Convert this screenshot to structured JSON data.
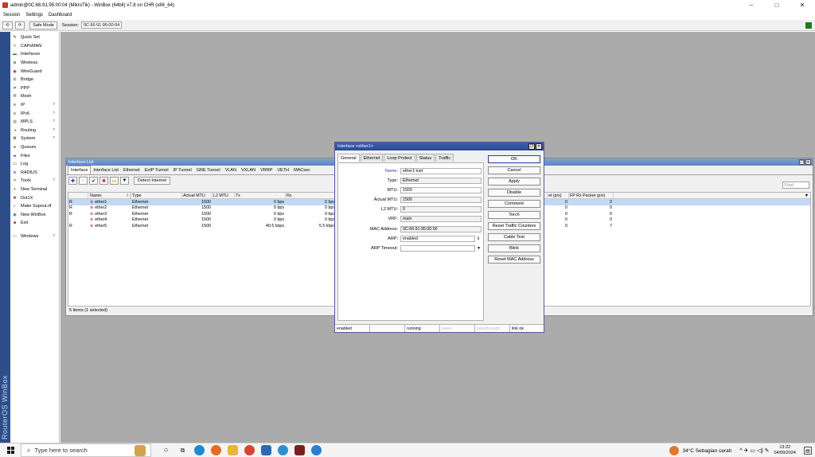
{
  "window": {
    "title": "admin@0C:66:91:95:00:04 (MikroTik) - WinBox (64bit) v7.8 on CHR (x86_64)",
    "minimize": "–",
    "maximize": "□",
    "close": "✕"
  },
  "menu": [
    "Session",
    "Settings",
    "Dashboard"
  ],
  "toolbar": {
    "undo": "⟲",
    "redo": "⟳",
    "safe_mode": "Safe Mode",
    "session_label": "Session:",
    "session_value": "0C:66:91:95:00:04"
  },
  "brand": "RouterOS WinBox",
  "sidebar": [
    {
      "label": "Quick Set",
      "icon": "✎",
      "arrow": ""
    },
    {
      "label": "CAPsMAN",
      "icon": "≈",
      "arrow": ""
    },
    {
      "label": "Interfaces",
      "icon": "▬",
      "arrow": ""
    },
    {
      "label": "Wireless",
      "icon": "≋",
      "arrow": ""
    },
    {
      "label": "WireGuard",
      "icon": "◉",
      "arrow": ""
    },
    {
      "label": "Bridge",
      "icon": "⊞",
      "arrow": ""
    },
    {
      "label": "PPP",
      "icon": "⇄",
      "arrow": ""
    },
    {
      "label": "Mesh",
      "icon": "⌘",
      "arrow": ""
    },
    {
      "label": "IP",
      "icon": "≡",
      "arrow": "?"
    },
    {
      "label": "IPv6",
      "icon": "≡",
      "arrow": "?"
    },
    {
      "label": "MPLS",
      "icon": "◎",
      "arrow": "?"
    },
    {
      "label": "Routing",
      "icon": "⇢",
      "arrow": "?"
    },
    {
      "label": "System",
      "icon": "⚙",
      "arrow": "?"
    },
    {
      "label": "Queues",
      "icon": "●",
      "arrow": ""
    },
    {
      "label": "Files",
      "icon": "▰",
      "arrow": ""
    },
    {
      "label": "Log",
      "icon": "▭",
      "arrow": ""
    },
    {
      "label": "RADIUS",
      "icon": "⊕",
      "arrow": ""
    },
    {
      "label": "Tools",
      "icon": "✕",
      "arrow": "?"
    },
    {
      "label": "New Terminal",
      "icon": "▪",
      "arrow": ""
    },
    {
      "label": "Dot1X",
      "icon": "✱",
      "arrow": ""
    },
    {
      "label": "Make Supout.rif",
      "icon": "◐",
      "arrow": ""
    },
    {
      "label": "New WinBox",
      "icon": "◉",
      "arrow": ""
    },
    {
      "label": "Exit",
      "icon": "■",
      "arrow": ""
    }
  ],
  "sidebar_bottom": {
    "label": "Windows",
    "icon": "▭",
    "arrow": "?"
  },
  "iflist": {
    "title": "Interface List",
    "tabs": [
      "Interface",
      "Interface List",
      "Ethernet",
      "EoIP Tunnel",
      "IP Tunnel",
      "GRE Tunnel",
      "VLAN",
      "VXLAN",
      "VRRP",
      "VETH",
      "MACsec"
    ],
    "detect_label": "Detect Internet",
    "find_placeholder": "Find",
    "columns": [
      "",
      "Name",
      "/",
      "Type",
      "Actual MTU",
      "L2 MTU",
      "Tx",
      "Rx",
      "",
      "et (p/s)",
      "FP Rx Packet (p/s)"
    ],
    "rows": [
      {
        "flag": "R",
        "name": "ether1",
        "type": "Ethernet",
        "mtu": "1500",
        "l2mtu": "",
        "tx": "0 bps",
        "rx": "0 bps",
        "fptx": "0",
        "fprx": "0",
        "selected": true
      },
      {
        "flag": "R",
        "name": "ether2",
        "type": "Ethernet",
        "mtu": "1500",
        "l2mtu": "",
        "tx": "0 bps",
        "rx": "0 bps",
        "fptx": "0",
        "fprx": "0",
        "selected": false
      },
      {
        "flag": "R",
        "name": "ether3",
        "type": "Ethernet",
        "mtu": "1500",
        "l2mtu": "",
        "tx": "0 bps",
        "rx": "0 bps",
        "fptx": "0",
        "fprx": "0",
        "selected": false
      },
      {
        "flag": "",
        "name": "ether4",
        "type": "Ethernet",
        "mtu": "1500",
        "l2mtu": "",
        "tx": "0 bps",
        "rx": "0 bps",
        "fptx": "0",
        "fprx": "0",
        "selected": false
      },
      {
        "flag": "R",
        "name": "ether5",
        "type": "Ethernet",
        "mtu": "1500",
        "l2mtu": "",
        "tx": "40.5 kbps",
        "rx": "5.5 kbps",
        "fptx": "0",
        "fprx": "7",
        "selected": false
      }
    ],
    "status": "5 items (1 selected)"
  },
  "dialog": {
    "title": "Interface <ether1>",
    "tabs": [
      "General",
      "Ethernet",
      "Loop Protect",
      "Status",
      "Traffic"
    ],
    "fields": [
      {
        "label": "Name:",
        "value": "ether1-inet",
        "readonly": false,
        "dropdown": ""
      },
      {
        "label": "Type:",
        "value": "Ethernet",
        "readonly": true,
        "dropdown": ""
      },
      {
        "label": "MTU:",
        "value": "1500",
        "readonly": false,
        "dropdown": ""
      },
      {
        "label": "Actual MTU:",
        "value": "1500",
        "readonly": true,
        "dropdown": ""
      },
      {
        "label": "L2 MTU:",
        "value": "0",
        "readonly": true,
        "dropdown": ""
      },
      {
        "label": "VRF:",
        "value": "main",
        "readonly": true,
        "dropdown": ""
      },
      {
        "label": "MAC Address:",
        "value": "0C:66:91:95:00:00",
        "readonly": true,
        "dropdown": ""
      },
      {
        "label": "ARP:",
        "value": "enabled",
        "readonly": false,
        "dropdown": "⇕"
      },
      {
        "label": "ARP Timeout:",
        "value": "",
        "readonly": false,
        "dropdown": "▼"
      }
    ],
    "buttons": [
      "OK",
      "Cancel",
      "Apply",
      "Disable",
      "Comment",
      "Torch",
      "Reset Traffic Counters",
      "Cable Test",
      "Blink",
      "Reset MAC Address"
    ],
    "status": [
      "enabled",
      "",
      "running",
      "slave",
      "passthrough",
      "link ok"
    ]
  },
  "taskbar": {
    "search_placeholder": "Type here to search",
    "weather": "34°C  Sebagian cerah",
    "tray_icons": "^  ✈  ▭  ◁)  ✎",
    "time": "13:22",
    "date": "04/09/2024",
    "notification": "▤"
  }
}
